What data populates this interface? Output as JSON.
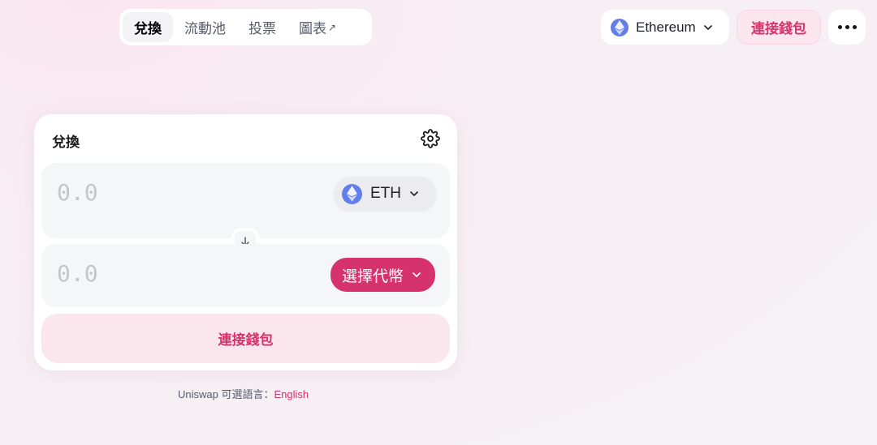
{
  "nav": {
    "tabs": [
      {
        "label": "兌換",
        "active": true
      },
      {
        "label": "流動池",
        "active": false
      },
      {
        "label": "投票",
        "active": false
      },
      {
        "label": "圖表",
        "active": false,
        "external_marker": "↗"
      }
    ]
  },
  "network": {
    "label": "Ethereum",
    "icon": "ethereum-icon"
  },
  "header": {
    "connect_label": "連接錢包",
    "more_icon": "ellipsis-icon"
  },
  "swap": {
    "title": "兌換",
    "settings_icon": "gear-icon",
    "input": {
      "placeholder": "0.0",
      "token": "ETH"
    },
    "output": {
      "placeholder": "0.0",
      "select_label": "選擇代幣"
    },
    "flip_icon": "arrow-down-icon",
    "connect_label": "連接錢包"
  },
  "footer": {
    "prefix": "Uniswap 可選語言：",
    "language_link": "English"
  },
  "colors": {
    "accent": "#d6336c",
    "accent_soft": "#fbe6ee",
    "eth": "#627eea"
  }
}
